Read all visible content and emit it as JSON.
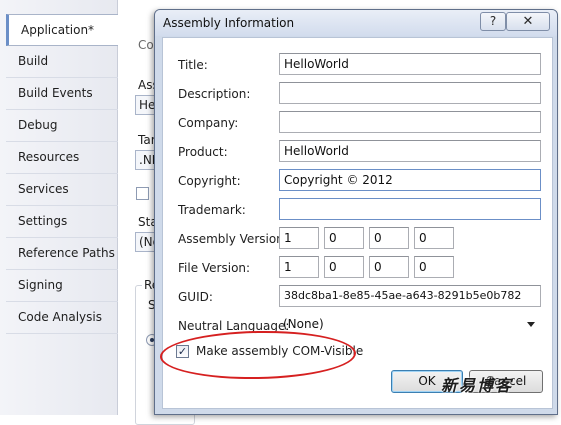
{
  "sidebar": {
    "tabs": [
      {
        "label": "Application*",
        "active": true
      },
      {
        "label": "Build"
      },
      {
        "label": "Build Events"
      },
      {
        "label": "Debug"
      },
      {
        "label": "Resources"
      },
      {
        "label": "Services"
      },
      {
        "label": "Settings"
      },
      {
        "label": "Reference Paths"
      },
      {
        "label": "Signing"
      },
      {
        "label": "Code Analysis"
      }
    ]
  },
  "main": {
    "fragments": {
      "top": "Co",
      "assembly_label": "Ass",
      "assembly_value": "He",
      "target_label": "Tar",
      "target_value": ".NE",
      "startup_label": "Sta",
      "startup_value": "(No",
      "resources_label": "Re",
      "resources_sub": "S"
    }
  },
  "dialog": {
    "title": "Assembly Information",
    "help_label": "?",
    "close_label": "✕",
    "fields": {
      "title": {
        "label": "Title:",
        "value": "HelloWorld"
      },
      "description": {
        "label": "Description:",
        "value": ""
      },
      "company": {
        "label": "Company:",
        "value": ""
      },
      "product": {
        "label": "Product:",
        "value": "HelloWorld"
      },
      "copyright": {
        "label": "Copyright:",
        "value": "Copyright ©  2012"
      },
      "trademark": {
        "label": "Trademark:",
        "value": ""
      },
      "assembly_version": {
        "label": "Assembly Version:",
        "parts": [
          "1",
          "0",
          "0",
          "0"
        ]
      },
      "file_version": {
        "label": "File Version:",
        "parts": [
          "1",
          "0",
          "0",
          "0"
        ]
      },
      "guid": {
        "label": "GUID:",
        "value": "38dc8ba1-8e85-45ae-a643-8291b5e0b782"
      },
      "neutral_language": {
        "label": "Neutral Language:",
        "value": "(None)"
      }
    },
    "com_visible": {
      "label": "Make assembly COM-Visible",
      "checked": true,
      "check_glyph": "✓"
    },
    "ok_label": "OK",
    "cancel_label": "Cancel"
  },
  "annotation": {
    "color": "#d62020"
  },
  "watermark": {
    "text": "新易博客"
  }
}
